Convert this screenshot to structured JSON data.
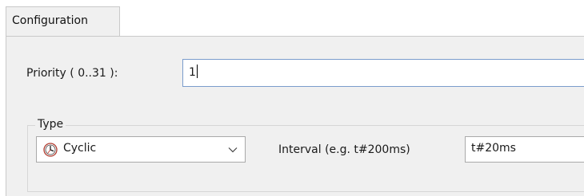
{
  "tabs": [
    {
      "label": "Configuration",
      "active": true
    }
  ],
  "priority": {
    "label": "Priority ( 0..31 ):",
    "value": "1"
  },
  "type_group": {
    "legend": "Type",
    "selected": "Cyclic",
    "selected_icon": "clock-icon"
  },
  "interval": {
    "label": "Interval (e.g. t#200ms)",
    "value": "t#20ms"
  },
  "colors": {
    "panel_background": "#f0f0f0",
    "focus_border": "#7a9ccc"
  }
}
